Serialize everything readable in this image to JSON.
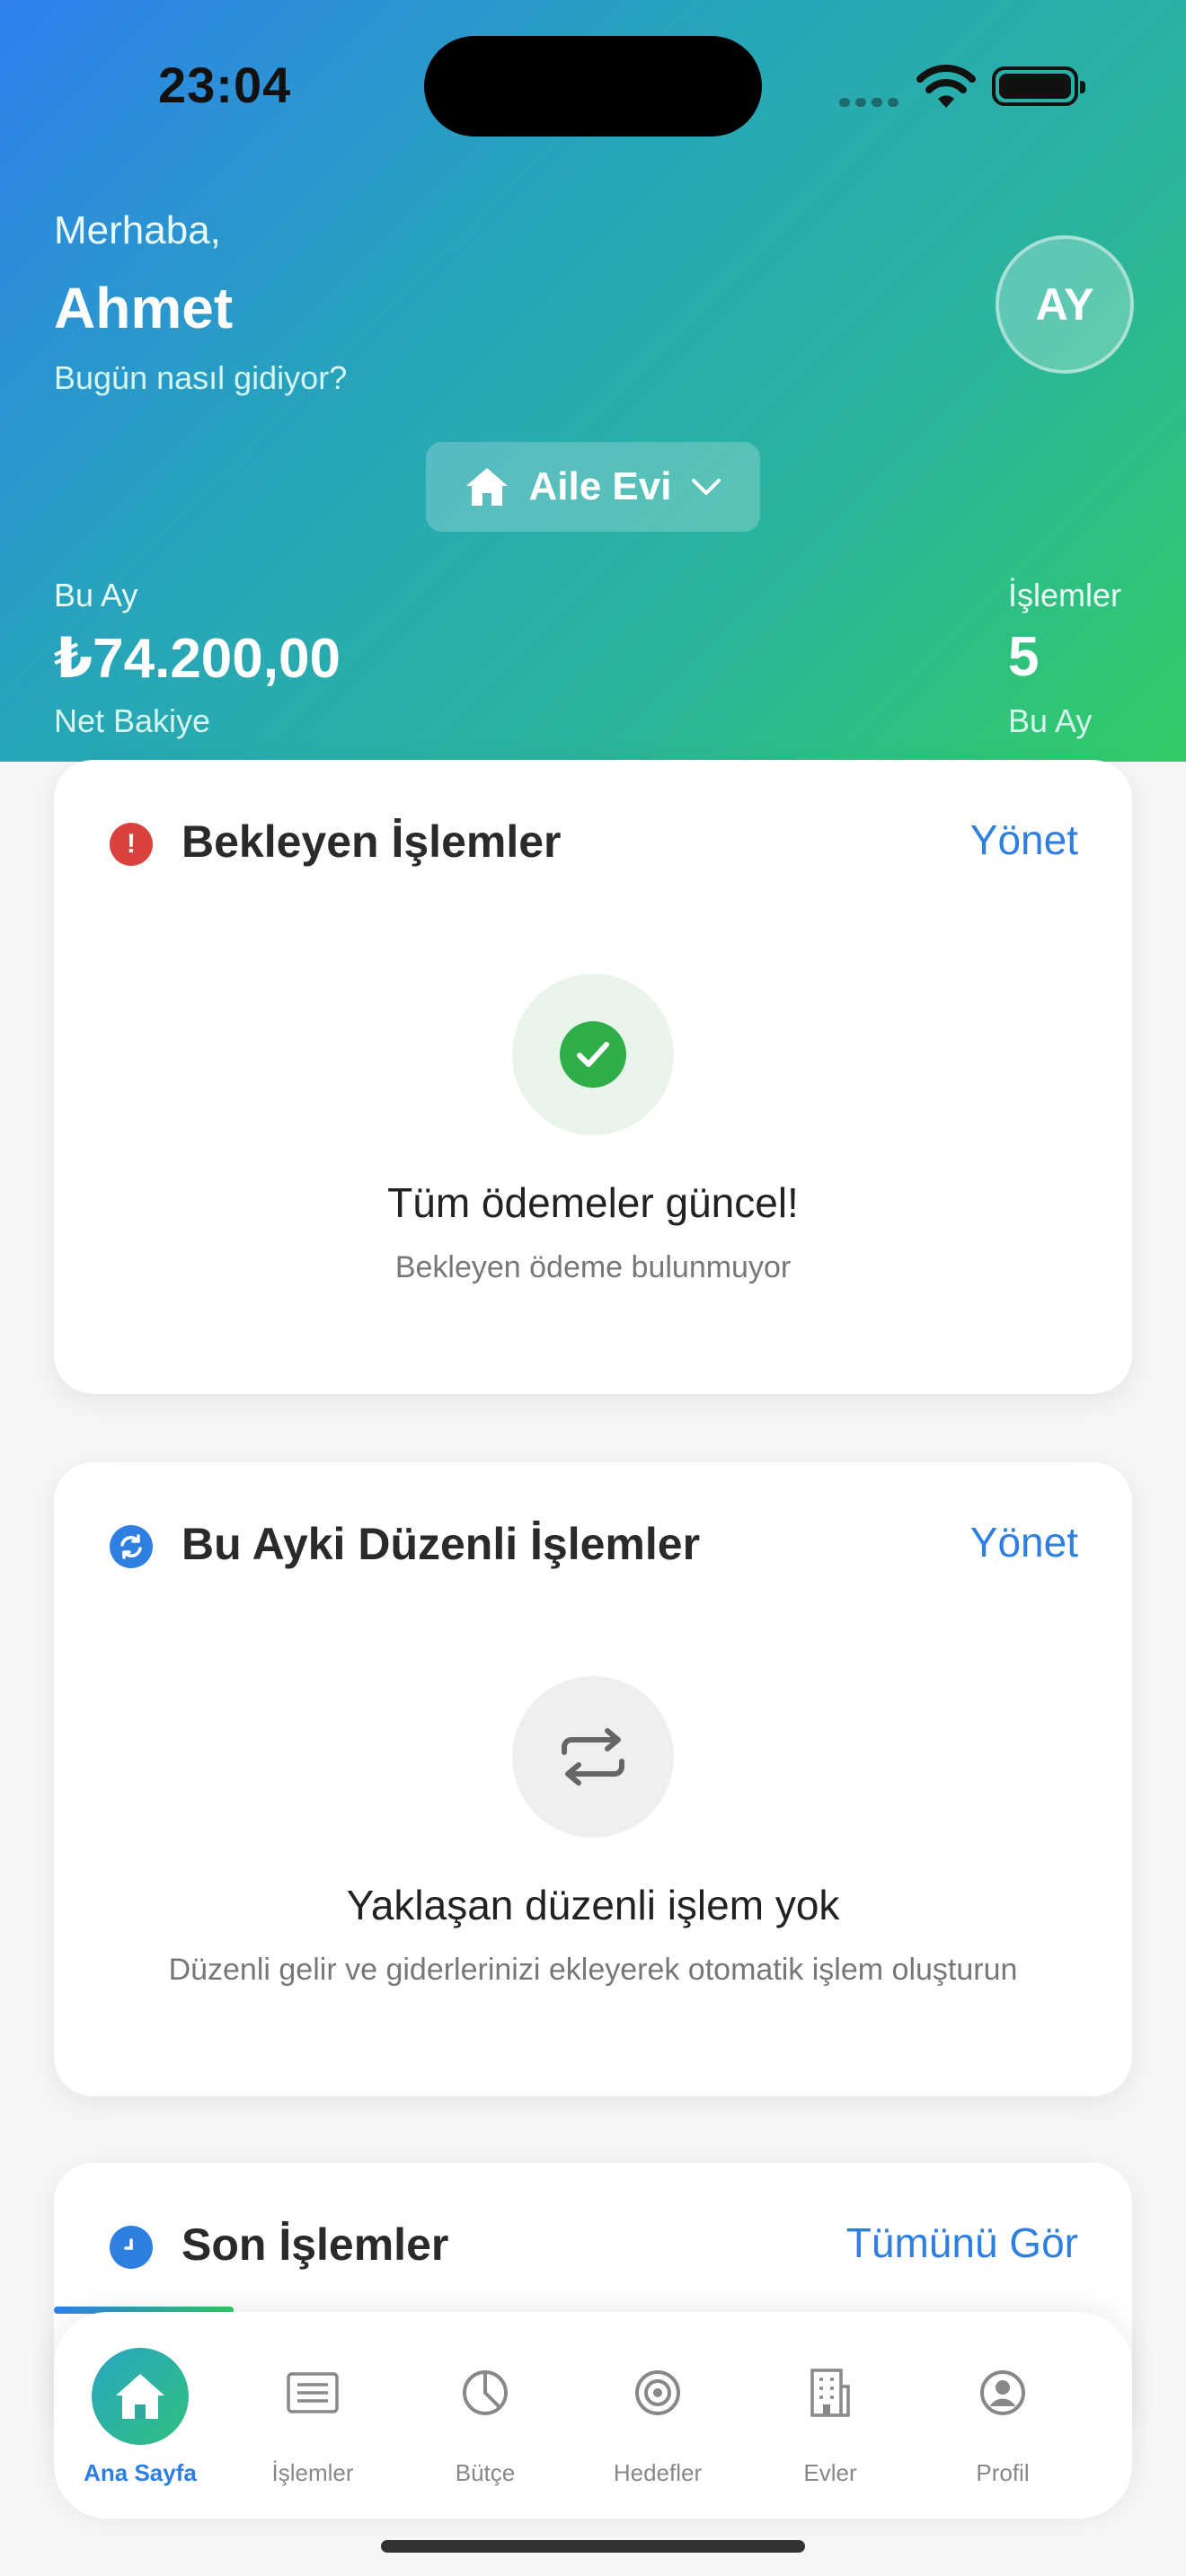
{
  "status_bar": {
    "time": "23:04"
  },
  "header": {
    "greeting": "Merhaba,",
    "user_name": "Ahmet",
    "subtitle": "Bugün nasıl gidiyor?",
    "avatar_initials": "AY",
    "house_selector": {
      "label": "Aile Evi",
      "icon": "house-icon"
    },
    "stats": {
      "left": {
        "label": "Bu Ay",
        "value": "₺74.200,00",
        "sub": "Net Bakiye"
      },
      "right": {
        "label": "İşlemler",
        "value": "5",
        "sub": "Bu Ay"
      }
    }
  },
  "pending_card": {
    "title": "Bekleyen İşlemler",
    "action": "Yönet",
    "icon": "exclamation-icon",
    "empty_title": "Tüm ödemeler güncel!",
    "empty_subtitle": "Bekleyen ödeme bulunmuyor"
  },
  "recurring_card": {
    "title": "Bu Ayki Düzenli İşlemler",
    "action": "Yönet",
    "icon": "repeat-icon",
    "empty_title": "Yaklaşan düzenli işlem yok",
    "empty_subtitle": "Düzenli gelir ve giderlerinizi ekleyerek otomatik işlem oluşturun"
  },
  "recent_card": {
    "title": "Son İşlemler",
    "action": "Tümünü Gör",
    "icon": "clock-icon"
  },
  "tab_bar": {
    "items": [
      {
        "label": "Ana Sayfa",
        "icon": "home-icon",
        "active": true
      },
      {
        "label": "İşlemler",
        "icon": "list-icon",
        "active": false
      },
      {
        "label": "Bütçe",
        "icon": "pie-chart-icon",
        "active": false
      },
      {
        "label": "Hedefler",
        "icon": "target-icon",
        "active": false
      },
      {
        "label": "Evler",
        "icon": "building-icon",
        "active": false
      },
      {
        "label": "Profil",
        "icon": "profile-icon",
        "active": false
      }
    ]
  },
  "colors": {
    "accent_blue": "#2f7fe0",
    "success_green": "#2fae4a",
    "danger_red": "#d9423d",
    "header_gradient_start": "#2f80ed",
    "header_gradient_end": "#33cc66"
  }
}
